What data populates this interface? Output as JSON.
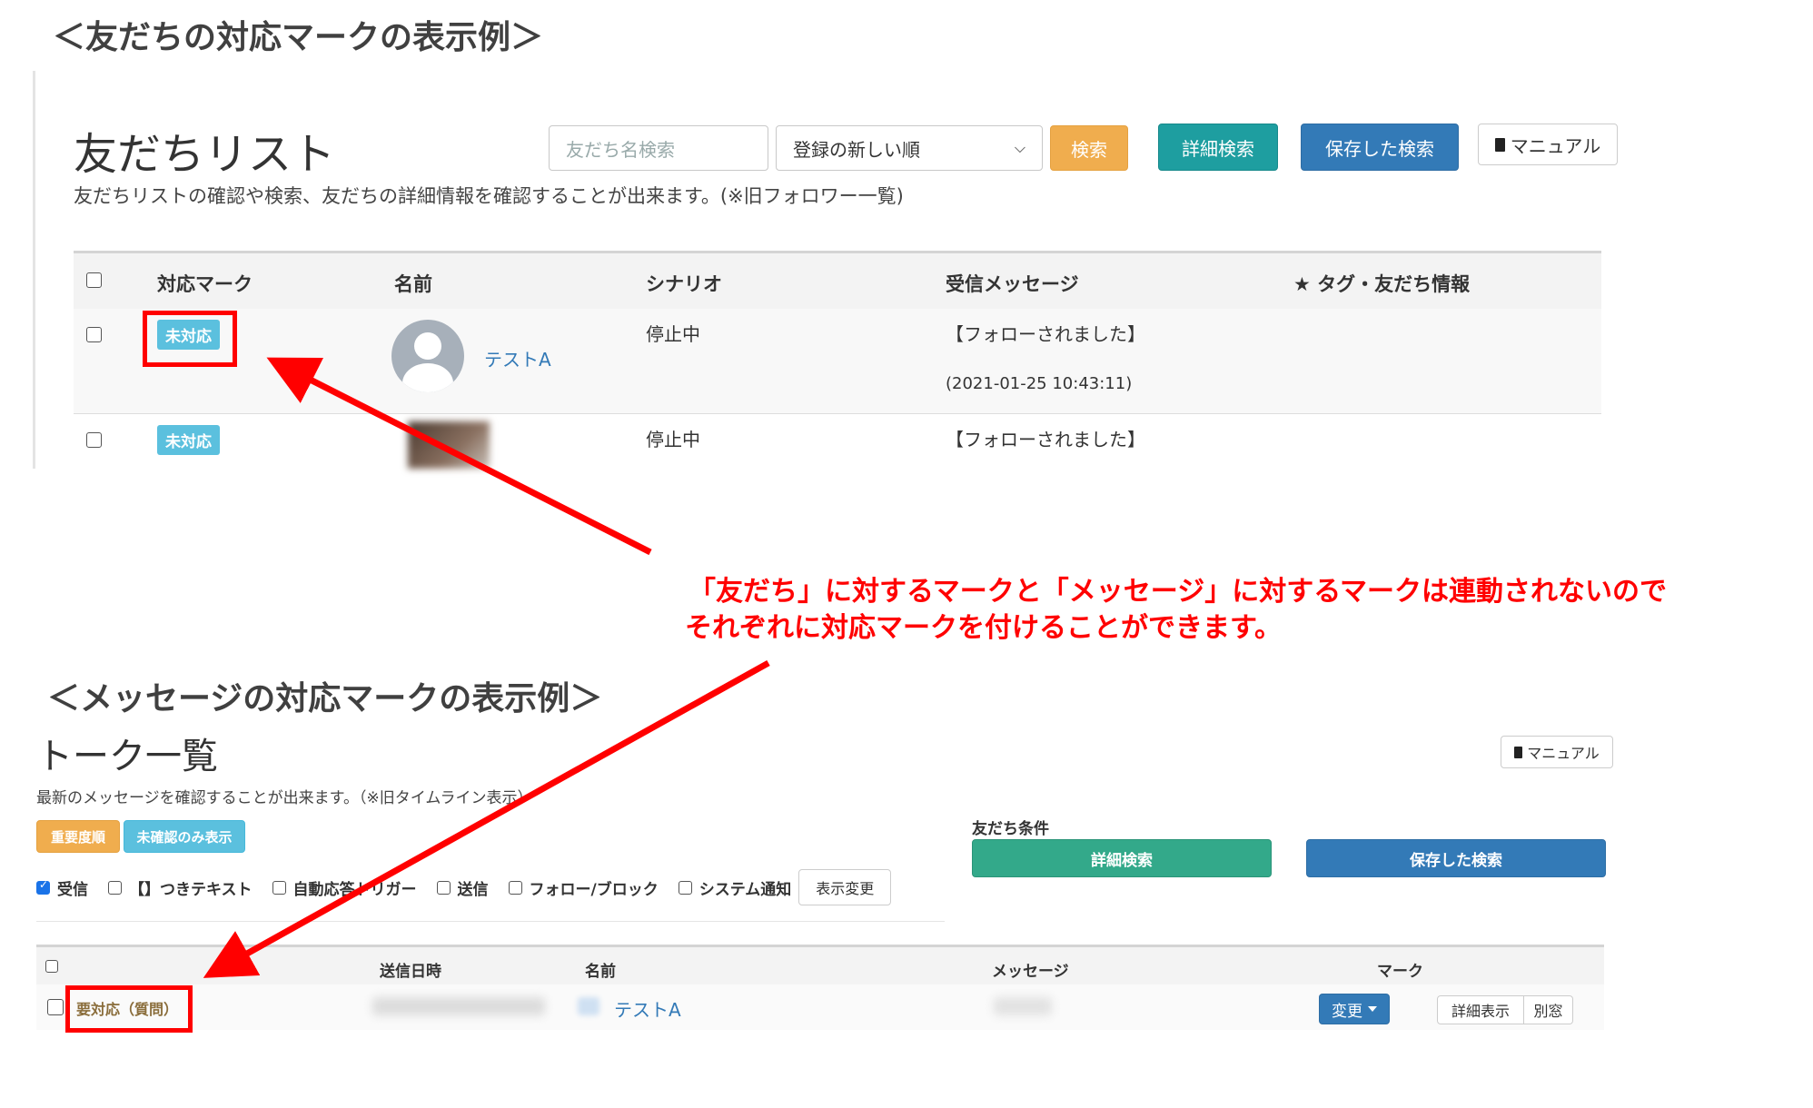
{
  "section1": {
    "heading": "＜友だちの対応マークの表示例＞",
    "title": "友だちリスト",
    "description": "友だちリストの確認や検索、友だちの詳細情報を確認することが出来ます。(※旧フォロワー一覧)",
    "search_placeholder": "友だち名検索",
    "sort_select": "登録の新しい順",
    "search_button": "検索",
    "detail_search_button": "詳細検索",
    "saved_search_button": "保存した検索",
    "manual_button": "マニュアル",
    "columns": [
      "対応マーク",
      "名前",
      "シナリオ",
      "受信メッセージ",
      "★ タグ・友だち情報"
    ],
    "rows": [
      {
        "mark": "未対応",
        "name": "テストA",
        "scenario": "停止中",
        "message": "【フォローされました】",
        "datetime": "(2021-01-25 10:43:11)"
      },
      {
        "mark": "未対応",
        "name": "",
        "scenario": "停止中",
        "message": "【フォローされました】",
        "datetime": ""
      }
    ]
  },
  "annotation": {
    "line1": "「友だち」に対するマークと「メッセージ」に対するマークは連動されないので",
    "line2": "それぞれに対応マークを付けることができます。",
    "arrow_color": "#ff0000"
  },
  "section2": {
    "heading": "＜メッセージの対応マークの表示例＞",
    "title": "トーク一覧",
    "description": "最新のメッセージを確認することが出来ます。（※旧タイムライン表示）",
    "important_button": "重要度順",
    "unconfirmed_button": "未確認のみ表示",
    "filters": [
      {
        "label": "受信",
        "checked": true
      },
      {
        "label": "【】つきテキスト",
        "checked": false
      },
      {
        "label": "自動応答トリガー",
        "checked": false
      },
      {
        "label": "送信",
        "checked": false
      },
      {
        "label": "フォロー/ブロック",
        "checked": false
      },
      {
        "label": "システム通知",
        "checked": false
      }
    ],
    "display_change_button": "表示変更",
    "manual_button": "マニュアル",
    "friend_condition_label": "友だち条件",
    "detail_search_button": "詳細検索",
    "saved_search_button": "保存した検索",
    "columns": [
      "送信日時",
      "名前",
      "メッセージ",
      "マーク"
    ],
    "row": {
      "status": "要対応（質問）",
      "name": "テストA",
      "change_button": "変更",
      "detail_button": "詳細表示",
      "separate_window_button": "別窓"
    }
  },
  "colors": {
    "orange": "#f0ad4e",
    "teal": "#1e9ea0",
    "green": "#33a98a",
    "blue": "#337ab7",
    "info": "#5bc0de",
    "red": "#ff0000",
    "status_brown": "#8a6d3b"
  }
}
